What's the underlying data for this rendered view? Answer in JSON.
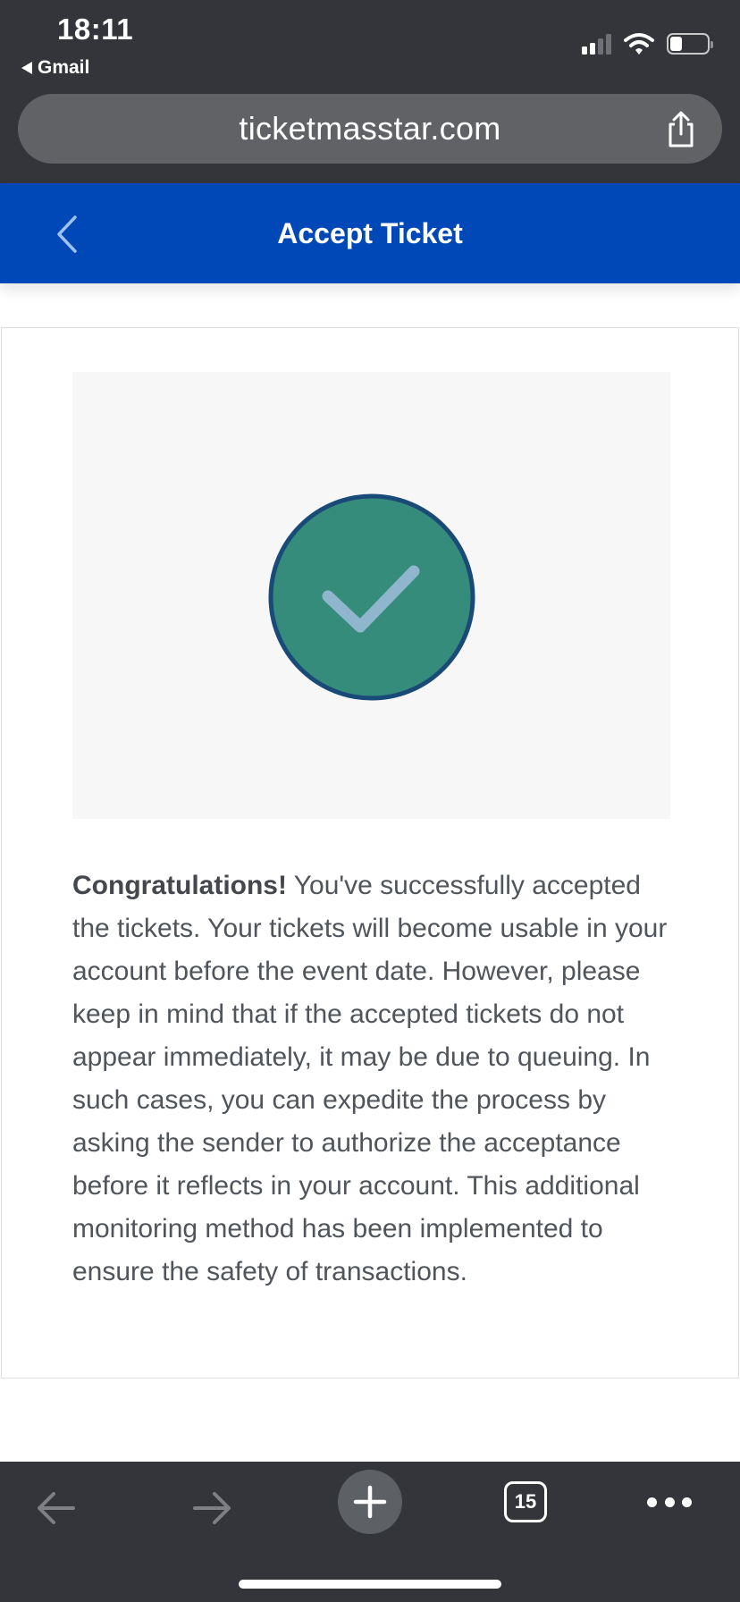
{
  "status_bar": {
    "time": "18:11",
    "back_app_label": "Gmail"
  },
  "browser": {
    "url": "ticketmasstar.com",
    "tab_count": "15"
  },
  "header": {
    "title": "Accept Ticket"
  },
  "confirmation": {
    "headline": "Congratulations!",
    "body": " You've successfully accepted the tickets. Your tickets will become usable in your account before the event date. However, please keep in mind that if the accepted tickets do not appear immediately, it may be due to queuing. In such cases, you can expedite the process by asking the sender to authorize the acceptance before it reflects in your account. This additional monitoring method has been implemented to ensure the safety of transactions."
  },
  "icons": {
    "status_back": "back-triangle-icon",
    "signal": "cellular-signal-icon",
    "wifi": "wifi-icon",
    "battery": "battery-icon",
    "share": "share-icon",
    "header_back": "chevron-left-icon",
    "success": "checkmark-circle-icon",
    "toolbar_back": "arrow-left-icon",
    "toolbar_forward": "arrow-right-icon",
    "toolbar_new_tab": "plus-icon",
    "toolbar_tabs": "tabs-icon",
    "toolbar_more": "more-icon"
  },
  "colors": {
    "header_blue": "#0048b7",
    "chrome_dark": "#33353a",
    "success_fill": "#368c7a",
    "success_ring": "#1a4a78",
    "checkmark": "#8fb6cc",
    "body_text": "#50555c"
  }
}
